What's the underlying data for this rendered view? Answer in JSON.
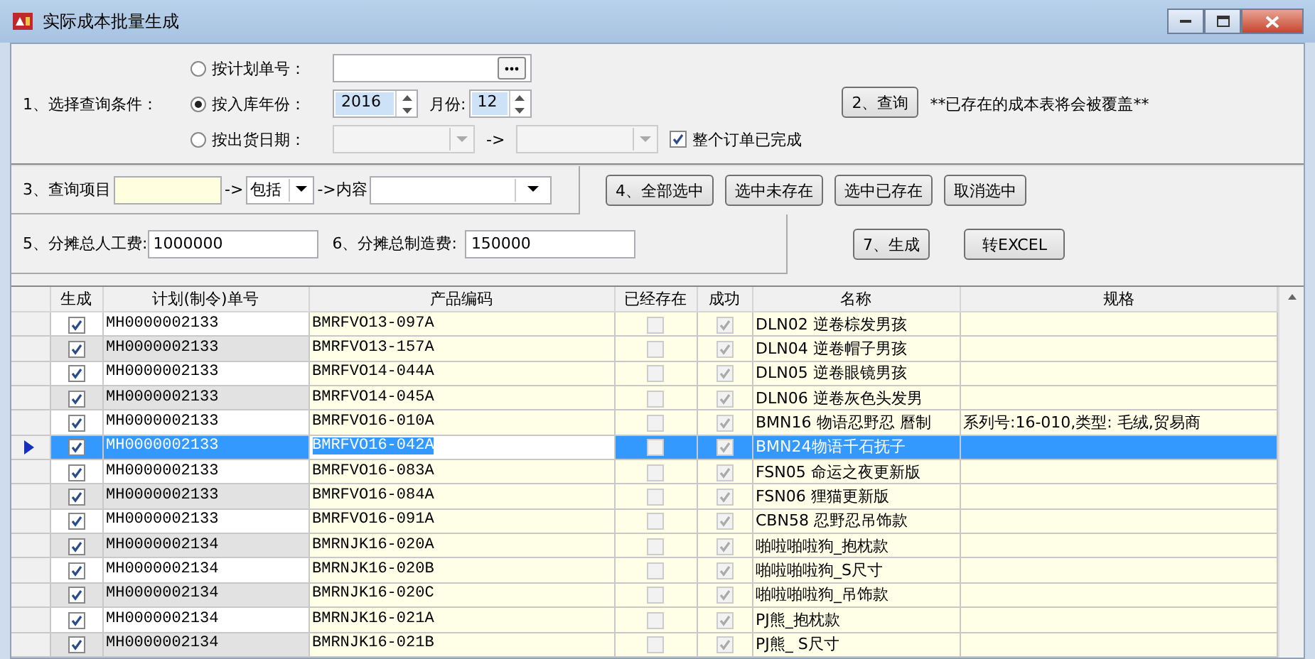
{
  "window": {
    "title": "实际成本批量生成"
  },
  "query": {
    "label": "1、选择查询条件：",
    "options": [
      {
        "label": "按计划单号：",
        "selected": false,
        "kind": "plan"
      },
      {
        "label": "按入库年份：",
        "selected": true,
        "kind": "year"
      },
      {
        "label": "按出货日期：",
        "selected": false,
        "kind": "date"
      }
    ],
    "year": "2016",
    "month_label": "月份:",
    "month": "12",
    "date_arrow": "->",
    "complete": {
      "label": "整个订单已完成",
      "checked": true
    },
    "button": "2、查询",
    "note": "**已存在的成本表将会被覆盖**"
  },
  "filter": {
    "label": "3、查询项目",
    "arrow": "->",
    "operator": "包括",
    "content_label": "->内容"
  },
  "select_buttons": [
    "4、全部选中",
    "选中未存在",
    "选中已存在",
    "取消选中"
  ],
  "allocation": {
    "labor_label": "5、分摊总人工费:",
    "labor": "1000000",
    "overhead_label": "6、分摊总制造费:",
    "overhead": "150000",
    "generate_button": "7、生成",
    "excel_button": "转EXCEL"
  },
  "table": {
    "columns": [
      "生成",
      "计划(制令)单号",
      "产品编码",
      "已经存在",
      "成功",
      "名称",
      "规格"
    ],
    "rows": [
      {
        "generate": true,
        "order": "MH0000002133",
        "code": "BMRFVO13-097A",
        "exists": false,
        "success": true,
        "name": "DLN02 逆卷棕发男孩",
        "selected": false
      },
      {
        "generate": true,
        "order": "MH0000002133",
        "code": "BMRFVO13-157A",
        "exists": false,
        "success": true,
        "name": "DLN04 逆卷帽子男孩",
        "selected": false
      },
      {
        "generate": true,
        "order": "MH0000002133",
        "code": "BMRFVO14-044A",
        "exists": false,
        "success": true,
        "name": "DLN05 逆卷眼镜男孩",
        "selected": false
      },
      {
        "generate": true,
        "order": "MH0000002133",
        "code": "BMRFVO14-045A",
        "exists": false,
        "success": true,
        "name": "DLN06 逆卷灰色头发男",
        "selected": false
      },
      {
        "generate": true,
        "order": "MH0000002133",
        "code": "BMRFVO16-010A",
        "exists": false,
        "success": true,
        "name": "BMN16 物语忍野忍 曆制",
        "spec": "系列号:16-010,类型: 毛绒,贸易商",
        "selected": false
      },
      {
        "generate": true,
        "order": "MH0000002133",
        "code": "BMRFVO16-042A",
        "exists": false,
        "success": true,
        "name": "BMN24物语千石抚子",
        "selected": true
      },
      {
        "generate": true,
        "order": "MH0000002133",
        "code": "BMRFVO16-083A",
        "exists": false,
        "success": true,
        "name": "FSN05 命运之夜更新版",
        "selected": false
      },
      {
        "generate": true,
        "order": "MH0000002133",
        "code": "BMRFVO16-084A",
        "exists": false,
        "success": true,
        "name": "FSN06 狸猫更新版",
        "selected": false
      },
      {
        "generate": true,
        "order": "MH0000002133",
        "code": "BMRFVO16-091A",
        "exists": false,
        "success": true,
        "name": "CBN58 忍野忍吊饰款",
        "selected": false
      },
      {
        "generate": true,
        "order": "MH0000002134",
        "code": "BMRNJK16-020A",
        "exists": false,
        "success": true,
        "name": "啪啦啪啦狗_抱枕款",
        "selected": false
      },
      {
        "generate": true,
        "order": "MH0000002134",
        "code": "BMRNJK16-020B",
        "exists": false,
        "success": true,
        "name": "啪啦啪啦狗_S尺寸",
        "selected": false
      },
      {
        "generate": true,
        "order": "MH0000002134",
        "code": "BMRNJK16-020C",
        "exists": false,
        "success": true,
        "name": "啪啦啪啦狗_吊饰款",
        "selected": false
      },
      {
        "generate": true,
        "order": "MH0000002134",
        "code": "BMRNJK16-021A",
        "exists": false,
        "success": true,
        "name": "PJ熊_抱枕款",
        "selected": false
      },
      {
        "generate": true,
        "order": "MH0000002134",
        "code": "BMRNJK16-021B",
        "exists": false,
        "success": true,
        "name": "PJ熊_ S尺寸",
        "selected": false
      }
    ]
  }
}
